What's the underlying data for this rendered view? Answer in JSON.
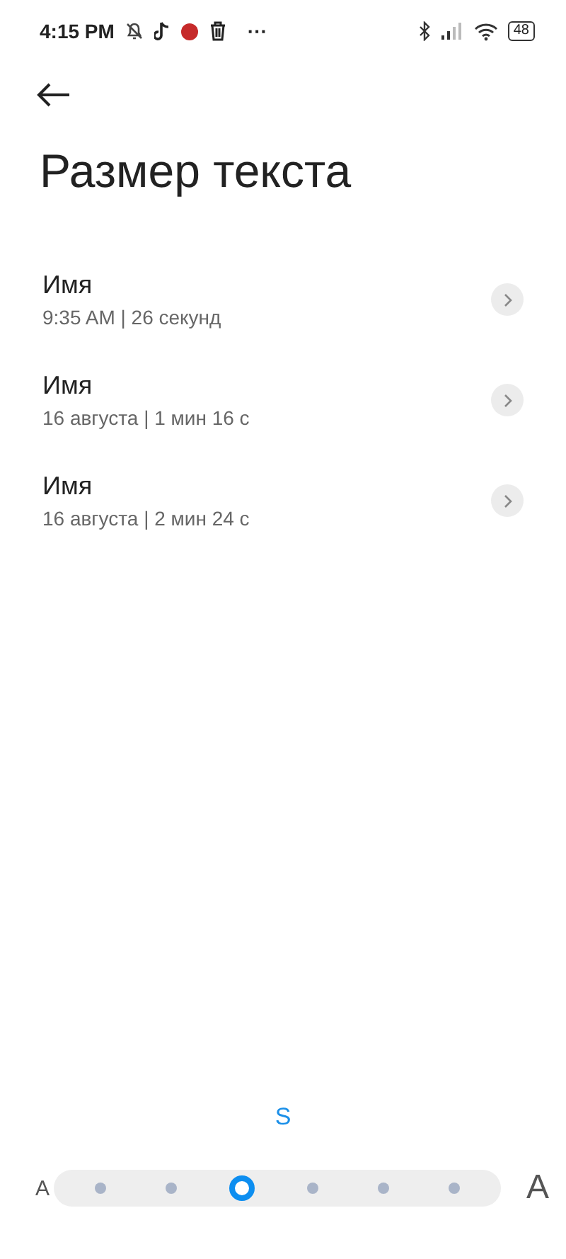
{
  "status_bar": {
    "time": "4:15 PM",
    "more": "···",
    "battery": "48"
  },
  "title": "Размер текста",
  "items": [
    {
      "name": "Имя",
      "details": "9:35 AM | 26 секунд"
    },
    {
      "name": "Имя",
      "details": "16 августа | 1 мин 16 с"
    },
    {
      "name": "Имя",
      "details": "16 августа | 2 мин 24 с"
    }
  ],
  "size_label": "S",
  "slider": {
    "min_label": "A",
    "max_label": "A",
    "steps": [
      {
        "selected": false
      },
      {
        "selected": false
      },
      {
        "selected": true
      },
      {
        "selected": false
      },
      {
        "selected": false
      },
      {
        "selected": false
      }
    ]
  }
}
